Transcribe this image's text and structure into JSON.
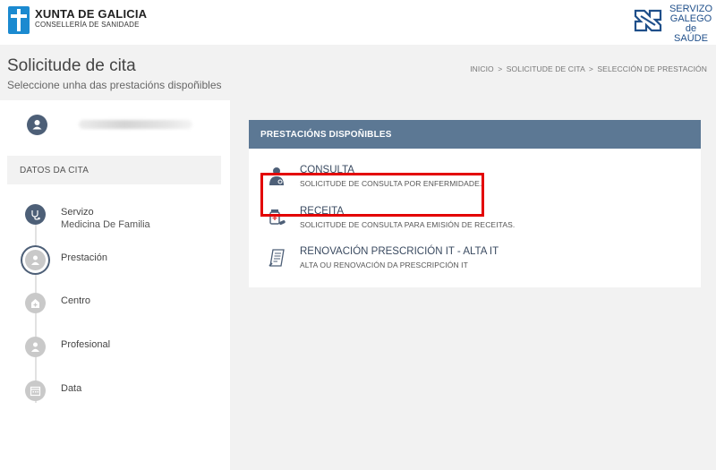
{
  "header": {
    "xunta_title": "XUNTA DE GALICIA",
    "xunta_subtitle": "CONSELLERÍA DE SANIDADE",
    "sergas_line1": "SERVIZO",
    "sergas_line2": "GALEGO",
    "sergas_line3": "de SAÚDE"
  },
  "page": {
    "title": "Solicitude de cita",
    "subtitle": "Seleccione unha das prestacións dispoñibles",
    "breadcrumb": [
      "INICIO",
      "SOLICITUDE DE CITA",
      "SELECCIÓN DE PRESTACIÓN"
    ],
    "breadcrumb_separator": ">"
  },
  "sidebar": {
    "section_title": "DATOS DA CITA",
    "steps": [
      {
        "label": "Servizo",
        "value": "Medicina De Familia",
        "icon": "stethoscope-icon",
        "state": "done"
      },
      {
        "label": "Prestación",
        "value": "",
        "icon": "user-icon",
        "state": "current"
      },
      {
        "label": "Centro",
        "value": "",
        "icon": "hospital-icon",
        "state": "pending"
      },
      {
        "label": "Profesional",
        "value": "",
        "icon": "user-icon",
        "state": "pending"
      },
      {
        "label": "Data",
        "value": "",
        "icon": "calendar-icon",
        "state": "pending"
      }
    ]
  },
  "panel": {
    "title": "PRESTACIÓNS DISPOÑIBLES",
    "options": [
      {
        "title": "CONSULTA",
        "description": "SOLICITUDE DE CONSULTA POR ENFERMIDADE.",
        "icon": "doctor-icon"
      },
      {
        "title": "RECEITA",
        "description": "SOLICITUDE DE CONSULTA PARA EMISIÓN DE RECEITAS.",
        "icon": "medicine-icon"
      },
      {
        "title": "RENOVACIÓN PRESCRICIÓN IT - ALTA IT",
        "description": "ALTA OU RENOVACIÓN DA PRESCRIPCIÓN IT",
        "icon": "document-pen-icon"
      }
    ]
  },
  "colors": {
    "header_bar": "#5c7894",
    "step_active": "#4d5f77",
    "step_pending": "#c9c9c9",
    "highlight": "#e30000",
    "xunta_blue": "#1b8ad0"
  }
}
